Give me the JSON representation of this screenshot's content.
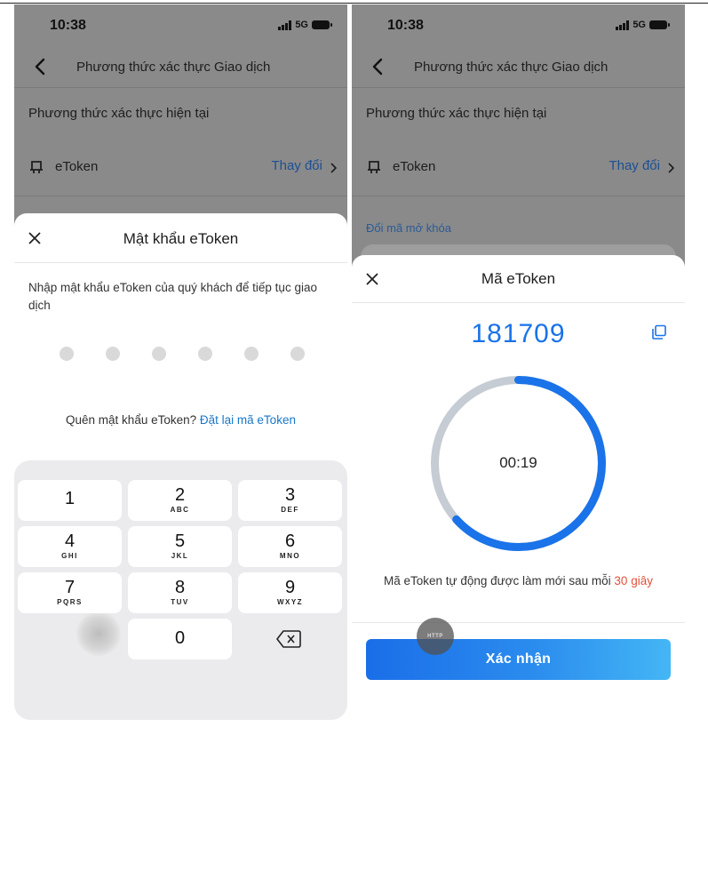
{
  "left_screen": {
    "status": {
      "time": "10:38",
      "network": "5G"
    },
    "nav": {
      "title": "Phương thức xác thực Giao dịch"
    },
    "current_method_heading": "Phương thức xác thực hiện tại",
    "method": {
      "label": "eToken",
      "change_label": "Thay đổi"
    },
    "sheet": {
      "title": "Mật khẩu eToken",
      "prompt": "Nhập mật khẩu eToken của quý khách để tiếp tục giao dịch",
      "pin_length": 6,
      "forgot_text": "Quên mật khẩu eToken?",
      "reset_link": "Đặt lại mã eToken"
    },
    "keypad": {
      "keys": [
        {
          "num": "1",
          "letters": ""
        },
        {
          "num": "2",
          "letters": "ABC"
        },
        {
          "num": "3",
          "letters": "DEF"
        },
        {
          "num": "4",
          "letters": "GHI"
        },
        {
          "num": "5",
          "letters": "JKL"
        },
        {
          "num": "6",
          "letters": "MNO"
        },
        {
          "num": "7",
          "letters": "PQRS"
        },
        {
          "num": "8",
          "letters": "TUV"
        },
        {
          "num": "9",
          "letters": "WXYZ"
        }
      ],
      "zero": "0"
    }
  },
  "right_screen": {
    "status": {
      "time": "10:38",
      "network": "5G"
    },
    "nav": {
      "title": "Phương thức xác thực Giao dịch"
    },
    "current_method_heading": "Phương thức xác thực hiện tại",
    "method": {
      "label": "eToken",
      "change_label": "Thay đổi"
    },
    "unlock_link": "Đổi mã mở khóa",
    "sheet": {
      "title": "Mã eToken",
      "code": "181709",
      "timer": "00:19",
      "timer_remaining_fraction": 0.633,
      "refresh_text": "Mã eToken tự động được làm mới sau mỗi",
      "refresh_interval": "30 giây",
      "confirm_label": "Xác nhận",
      "touch_indicator": "HTTP"
    }
  },
  "colors": {
    "accent_blue": "#1a73e8",
    "link_blue": "#1877c9",
    "highlight_red": "#e2513b",
    "ring_track": "#c5ccd3",
    "dim_overlay": "#8a8a8a"
  }
}
